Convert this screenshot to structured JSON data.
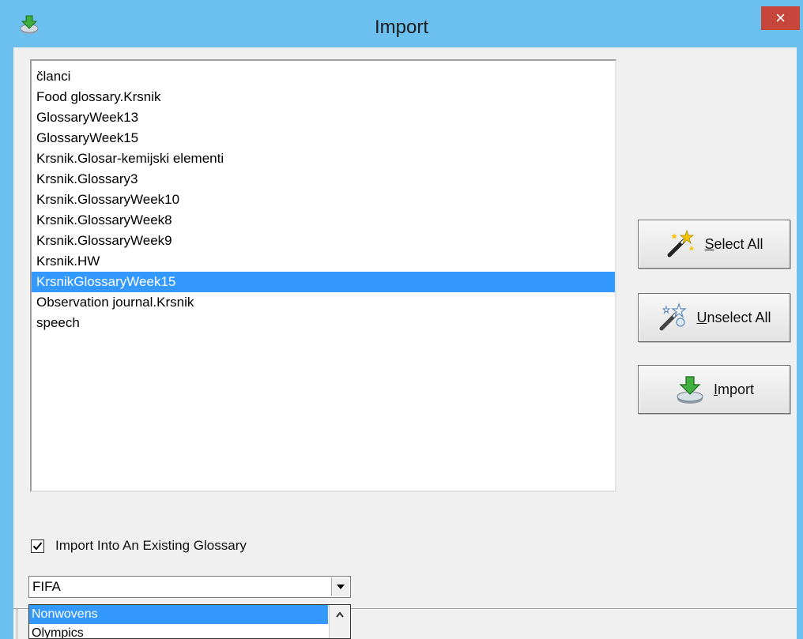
{
  "window": {
    "title": "Import",
    "close_glyph": "×",
    "app_icon": "import-arrow-icon",
    "title_bar_color": "#6cc0ef",
    "close_color": "#c7463c"
  },
  "glossary_list": {
    "items": [
      {
        "label": "članci",
        "selected": false
      },
      {
        "label": "Food glossary.Krsnik",
        "selected": false
      },
      {
        "label": "GlossaryWeek13",
        "selected": false
      },
      {
        "label": "GlossaryWeek15",
        "selected": false
      },
      {
        "label": "Krsnik.Glosar-kemijski elementi",
        "selected": false
      },
      {
        "label": "Krsnik.Glossary3",
        "selected": false
      },
      {
        "label": "Krsnik.GlossaryWeek10",
        "selected": false
      },
      {
        "label": "Krsnik.GlossaryWeek8",
        "selected": false
      },
      {
        "label": "Krsnik.GlossaryWeek9",
        "selected": false
      },
      {
        "label": "Krsnik.HW",
        "selected": false
      },
      {
        "label": "KrsnikGlossaryWeek15",
        "selected": true
      },
      {
        "label": "Observation journal.Krsnik",
        "selected": false
      },
      {
        "label": "speech",
        "selected": false
      }
    ],
    "selection_color": "#3399ff"
  },
  "buttons": {
    "select_all": {
      "mnemonic": "S",
      "rest": "elect All",
      "icon": "magic-wand-icon"
    },
    "unselect_all": {
      "mnemonic": "U",
      "rest": "nselect All",
      "icon": "magic-wand-clear-icon"
    },
    "import": {
      "mnemonic": "I",
      "rest": "mport",
      "icon": "import-arrow-icon"
    }
  },
  "existing_glossary": {
    "checkbox_label": "Import Into An Existing Glossary",
    "checked": true,
    "selected_value": "FIFA",
    "dropdown_options": [
      {
        "label": "Nonwovens",
        "selected": true
      },
      {
        "label": "Olympics",
        "selected": false
      }
    ]
  }
}
